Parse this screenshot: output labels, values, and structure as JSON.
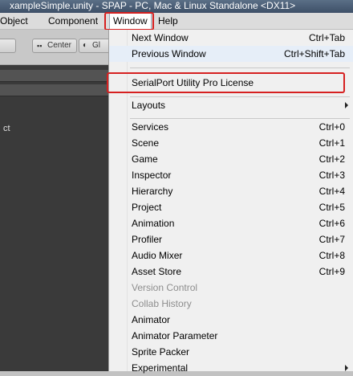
{
  "titlebar": {
    "title": "xampleSimple.unity - SPAP - PC, Mac & Linux Standalone <DX11>"
  },
  "menubar": {
    "items": [
      {
        "label": "Object"
      },
      {
        "label": "Component"
      },
      {
        "label": "Window"
      },
      {
        "label": "Help"
      }
    ]
  },
  "toolbar": {
    "pivot_label": "Center",
    "handle_label": "Gl"
  },
  "left_panel": {
    "text": "ct"
  },
  "menu": {
    "items": [
      {
        "label": "Next Window",
        "shortcut": "Ctrl+Tab"
      },
      {
        "label": "Previous Window",
        "shortcut": "Ctrl+Shift+Tab"
      },
      {
        "label": "SerialPort Utility Pro License",
        "shortcut": ""
      },
      {
        "label": "Layouts",
        "shortcut": ""
      },
      {
        "label": "Services",
        "shortcut": "Ctrl+0"
      },
      {
        "label": "Scene",
        "shortcut": "Ctrl+1"
      },
      {
        "label": "Game",
        "shortcut": "Ctrl+2"
      },
      {
        "label": "Inspector",
        "shortcut": "Ctrl+3"
      },
      {
        "label": "Hierarchy",
        "shortcut": "Ctrl+4"
      },
      {
        "label": "Project",
        "shortcut": "Ctrl+5"
      },
      {
        "label": "Animation",
        "shortcut": "Ctrl+6"
      },
      {
        "label": "Profiler",
        "shortcut": "Ctrl+7"
      },
      {
        "label": "Audio Mixer",
        "shortcut": "Ctrl+8"
      },
      {
        "label": "Asset Store",
        "shortcut": "Ctrl+9"
      },
      {
        "label": "Version Control",
        "shortcut": ""
      },
      {
        "label": "Collab History",
        "shortcut": ""
      },
      {
        "label": "Animator",
        "shortcut": ""
      },
      {
        "label": "Animator Parameter",
        "shortcut": ""
      },
      {
        "label": "Sprite Packer",
        "shortcut": ""
      },
      {
        "label": "Experimental",
        "shortcut": ""
      }
    ]
  },
  "colors": {
    "highlight_box": "#d62020",
    "disabled_text": "#8e8e8e",
    "menu_bg": "#f0f0f0"
  }
}
